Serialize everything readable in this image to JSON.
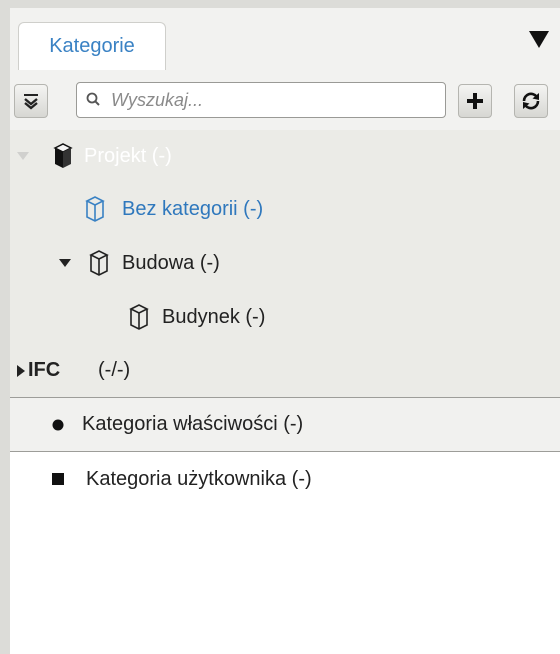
{
  "tabs": {
    "active": "Kategorie"
  },
  "search": {
    "placeholder": "Wyszukaj..."
  },
  "tree": {
    "project": "Projekt (-)",
    "no_category": "Bez kategorii (-)",
    "construction": "Budowa (-)",
    "building": "Budynek (-)",
    "ifc_name": "IFC",
    "ifc_count": "(-/-)"
  },
  "categories": {
    "property": "Kategoria właściwości (-)",
    "user": "Kategoria użytkownika (-)"
  },
  "colors": {
    "tab_text": "#3a82c4",
    "selected_row": "#8f8f8d",
    "no_category_text": "#2f78bd"
  },
  "icons": [
    "tab-menu-icon",
    "collapse-all-icon",
    "search-icon",
    "plus-icon",
    "refresh-icon",
    "expand-arrow-icon",
    "cube-icon"
  ]
}
